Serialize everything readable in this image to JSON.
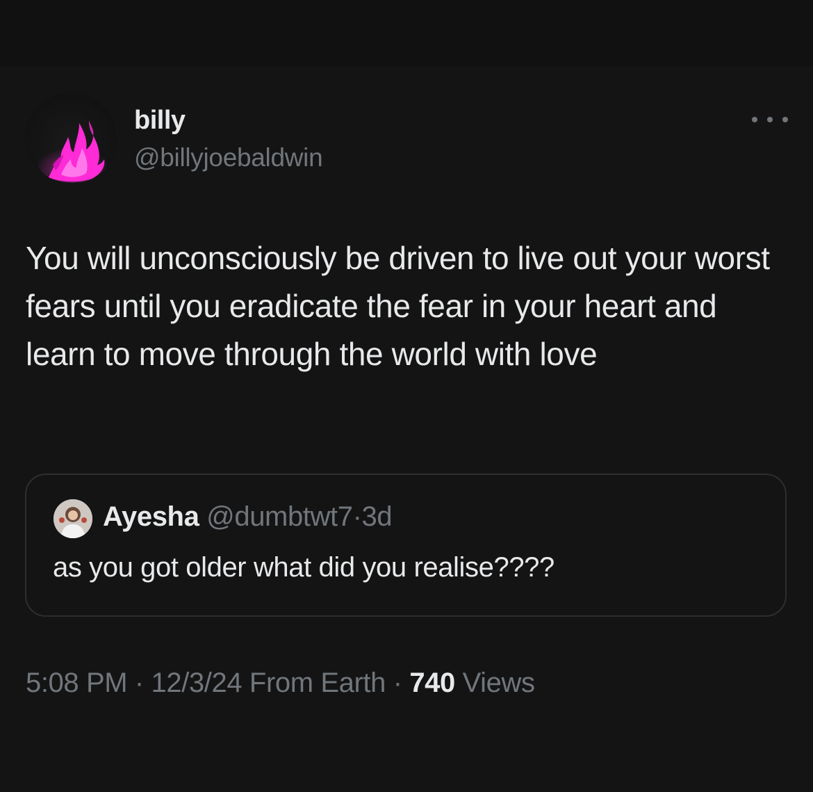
{
  "tweet": {
    "author": {
      "display_name": "billy",
      "handle": "@billyjoebaldwin",
      "avatar_icon": "pink-flame-avatar"
    },
    "more_icon": "more-options-icon",
    "text": "You will unconsciously be driven to live out your worst fears until you eradicate the fear in your heart and learn to move through the world with love",
    "quoted_tweet": {
      "display_name": "Ayesha",
      "handle": "@dumbtwt7",
      "separator": "·",
      "time": "3d",
      "text": "as you got older what did you realise????"
    },
    "meta": {
      "time": "5:08 PM",
      "separator": "·",
      "date": "12/3/24",
      "source": "From Earth",
      "views_count": "740",
      "views_label": "Views"
    }
  },
  "colors": {
    "background": "#141415",
    "text_primary": "#e7e9ea",
    "text_secondary": "#71767b",
    "border": "#2c2e31",
    "flame": "#ff2bd6"
  }
}
